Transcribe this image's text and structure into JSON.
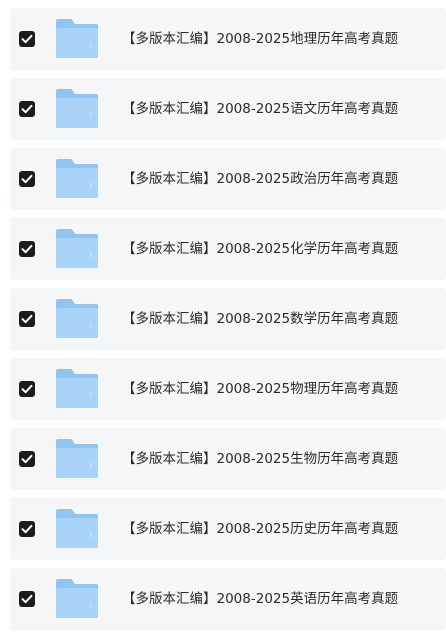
{
  "file_list": {
    "items": [
      {
        "name": "【多版本汇编】2008-2025地理历年高考真题",
        "checked": true,
        "icon": "folder-icon"
      },
      {
        "name": "【多版本汇编】2008-2025语文历年高考真题",
        "checked": true,
        "icon": "folder-icon"
      },
      {
        "name": "【多版本汇编】2008-2025政治历年高考真题",
        "checked": true,
        "icon": "folder-icon"
      },
      {
        "name": "【多版本汇编】2008-2025化学历年高考真题",
        "checked": true,
        "icon": "folder-icon"
      },
      {
        "name": "【多版本汇编】2008-2025数学历年高考真题",
        "checked": true,
        "icon": "folder-icon"
      },
      {
        "name": "【多版本汇编】2008-2025物理历年高考真题",
        "checked": true,
        "icon": "folder-icon"
      },
      {
        "name": "【多版本汇编】2008-2025生物历年高考真题",
        "checked": true,
        "icon": "folder-icon"
      },
      {
        "name": "【多版本汇编】2008-2025历史历年高考真题",
        "checked": true,
        "icon": "folder-icon"
      },
      {
        "name": "【多版本汇编】2008-2025英语历年高考真题",
        "checked": true,
        "icon": "folder-icon"
      }
    ]
  },
  "colors": {
    "row_background": "#f5f6f8",
    "checkbox_fill": "#1c1c1e",
    "folder_back": "#8fc5f3",
    "folder_front": "#a9d4f7",
    "text": "#2b2b2b"
  }
}
